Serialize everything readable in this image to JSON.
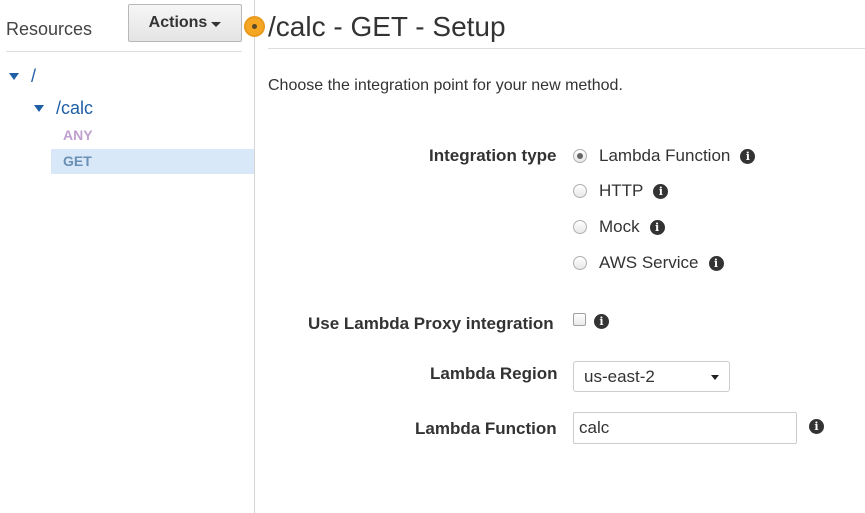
{
  "sidebar": {
    "title": "Resources",
    "actions_label": "Actions",
    "tree": {
      "root": "/",
      "child": "/calc",
      "methods": [
        "ANY",
        "GET"
      ]
    }
  },
  "main": {
    "title": "/calc - GET - Setup",
    "intro": "Choose the integration point for your new method.",
    "integration_type": {
      "label": "Integration type",
      "options": [
        "Lambda Function",
        "HTTP",
        "Mock",
        "AWS Service"
      ],
      "selected": "Lambda Function"
    },
    "proxy": {
      "label": "Use Lambda Proxy integration",
      "checked": false
    },
    "region": {
      "label": "Lambda Region",
      "value": "us-east-2"
    },
    "function": {
      "label": "Lambda Function",
      "value": "calc"
    }
  },
  "icons": {
    "info": "info-icon",
    "collapse": "triangle-down-icon",
    "caret": "caret-down-icon"
  },
  "colors": {
    "link_blue": "#1f5fa6",
    "selected_bg": "#d8e8f8",
    "orange_marker": "#f5a623",
    "any_method": "#c0a0d0"
  }
}
